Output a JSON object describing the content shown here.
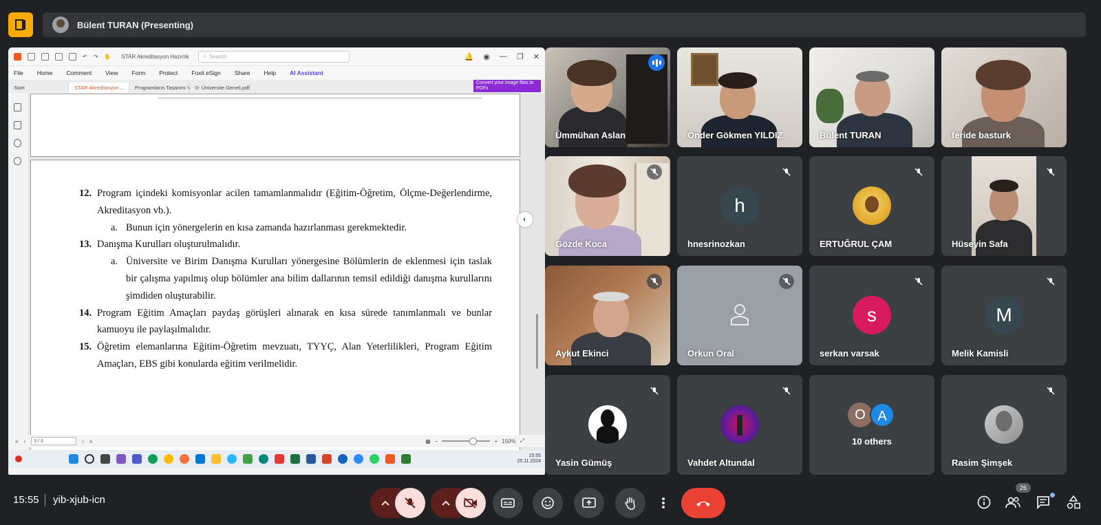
{
  "header": {
    "presenting_label": "Bülent TURAN (Presenting)"
  },
  "pdf": {
    "window_title": "STAR Akreditasyon Hazırlık Ça...",
    "search_placeholder": "Search",
    "menu": [
      "File",
      "Home",
      "Comment",
      "View",
      "Form",
      "Protect",
      "Foxit eSign",
      "Share",
      "Help",
      "AI Assistant"
    ],
    "tabs": [
      "Start",
      "STAR Akreditasyon ...",
      "Programların Tasarımı Y...",
      "0- Üniversite Geneli.pdf"
    ],
    "promo": "Convert your image files to PDFs",
    "page_indicator": "3 / 3",
    "zoom": "150%",
    "clock_time": "15:55",
    "clock_date": "25.11.2024"
  },
  "document": {
    "items": [
      {
        "num": "12.",
        "text": "Program içindeki komisyonlar acilen tamamlanmalıdır (Eğitim-Öğretim, Ölçme-Değerlendirme, Akreditasyon vb.).",
        "subs": [
          {
            "letter": "a.",
            "text": "Bunun için yönergelerin en kısa zamanda hazırlanması gerekmektedir."
          }
        ]
      },
      {
        "num": "13.",
        "text": "Danışma Kurulları oluşturulmalıdır.",
        "subs": [
          {
            "letter": "a.",
            "text": "Üniversite ve Birim Danışma Kurulları yönergesine Bölümlerin de eklenmesi için taslak bir çalışma yapılmış olup bölümler ana bilim dallarının temsil edildiği danışma kurullarını şimdiden oluşturabilir."
          }
        ]
      },
      {
        "num": "14.",
        "text": "Program Eğitim Amaçları paydaş görüşleri alınarak en kısa sürede tanımlanmalı ve bunlar kamuoyu ile paylaşılmalıdır.",
        "subs": []
      },
      {
        "num": "15.",
        "text": "Öğretim elemanlarına Eğitim-Öğretim mevzuatı, TYYÇ, Alan Yeterlilikleri, Program Eğitim Amaçları, EBS gibi konularda eğitim verilmelidir.",
        "subs": []
      }
    ]
  },
  "participants": [
    {
      "name": "Ümmühan Aslan",
      "type": "video",
      "speaking": true
    },
    {
      "name": "Önder Gökmen YILDIZ",
      "type": "video"
    },
    {
      "name": "Bülent TURAN",
      "type": "video"
    },
    {
      "name": "feride basturk",
      "type": "video"
    },
    {
      "name": "Gözde Koca",
      "type": "video",
      "muted": true
    },
    {
      "name": "hnesrinozkan",
      "type": "letter",
      "letter": "h",
      "color": "#37474f",
      "muted": true
    },
    {
      "name": "ERTUĞRUL ÇAM",
      "type": "photo",
      "muted": true
    },
    {
      "name": "Hüseyin Safa",
      "type": "video",
      "muted": true
    },
    {
      "name": "Aykut Ekinci",
      "type": "video",
      "muted": true
    },
    {
      "name": "Orkun Oral",
      "type": "icon",
      "muted": true
    },
    {
      "name": "serkan varsak",
      "type": "letter",
      "letter": "s",
      "color": "#d81b60",
      "muted": true
    },
    {
      "name": "Melik Kamisli",
      "type": "letter",
      "letter": "M",
      "color": "#37474f",
      "muted": true
    },
    {
      "name": "Yasin Gümüş",
      "type": "photo",
      "muted": true
    },
    {
      "name": "Vahdet Altundal",
      "type": "photo",
      "muted": true
    },
    {
      "name": "10 others",
      "type": "others",
      "letters": [
        "O",
        "A"
      ]
    },
    {
      "name": "Rasim Şimşek",
      "type": "photo",
      "muted": true
    }
  ],
  "footer": {
    "time": "15:55",
    "meeting_code": "yib-xjub-icn",
    "people_count": "26"
  },
  "colors": {
    "background": "#202124",
    "tile": "#3c4043",
    "accent": "#8ab4f8",
    "leave": "#ea4335"
  }
}
